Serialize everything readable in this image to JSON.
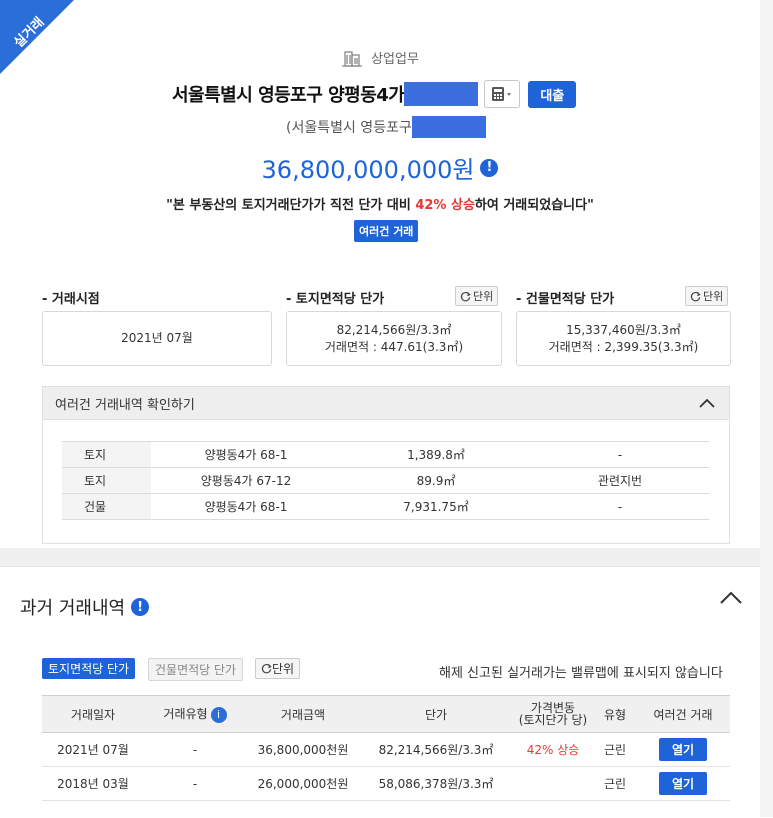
{
  "ribbon": "실거래",
  "property": {
    "type_label": "상업업무",
    "address": "서울특별시 영등포구 양평동4가",
    "sub_address": "(서울특별시 영등포구",
    "loan_button": "대출",
    "price": "36,800,000,000원",
    "quote_pre": "\"본 부동산의 토지거래단가가 직전 단가 대비 ",
    "quote_up": "42% 상승",
    "quote_post": "하여 거래되었습니다\"",
    "multi_badge": "여러건 거래",
    "colors": {
      "accent": "#1e63d8",
      "up": "#e53935"
    }
  },
  "summary": {
    "date_label": "- 거래시점",
    "date_value": "2021년 07월",
    "land_label": "- 토지면적당 단가",
    "land_unit_btn": "단위",
    "land_price": "82,214,566원/3.3㎡",
    "land_area": "거래면적 : 447.61(3.3㎡)",
    "bldg_label": "- 건물면적당 단가",
    "bldg_unit_btn": "단위",
    "bldg_price": "15,337,460원/3.3㎡",
    "bldg_area": "거래면적 : 2,399.35(3.3㎡)"
  },
  "multi": {
    "title": "여러건 거래내역 확인하기",
    "rows": [
      {
        "kind": "토지",
        "lot": "양평동4가 68-1",
        "area": "1,389.8㎡",
        "note": "-"
      },
      {
        "kind": "토지",
        "lot": "양평동4가 67-12",
        "area": "89.9㎡",
        "note": "관련지번"
      },
      {
        "kind": "건물",
        "lot": "양평동4가 68-1",
        "area": "7,931.75㎡",
        "note": "-"
      }
    ]
  },
  "history": {
    "title": "과거 거래내역",
    "tab_land": "토지면적당 단가",
    "tab_bldg": "건물면적당 단가",
    "unit_btn": "단위",
    "notice": "해제 신고된 실거래가는 밸류맵에 표시되지 않습니다",
    "headers": {
      "date": "거래일자",
      "type": "거래유형",
      "amount": "거래금액",
      "unit_price": "단가",
      "change_1": "가격변동",
      "change_2": "(토지단가 당)",
      "use": "유형",
      "multi": "여러건 거래"
    },
    "rows": [
      {
        "date": "2021년 07월",
        "type": "-",
        "amount": "36,800,000천원",
        "unit_price": "82,214,566원/3.3㎡",
        "change": "42% 상승",
        "use": "근린",
        "open": "열기"
      },
      {
        "date": "2018년 03월",
        "type": "-",
        "amount": "26,000,000천원",
        "unit_price": "58,086,378원/3.3㎡",
        "change": "",
        "use": "근린",
        "open": "열기"
      }
    ]
  }
}
